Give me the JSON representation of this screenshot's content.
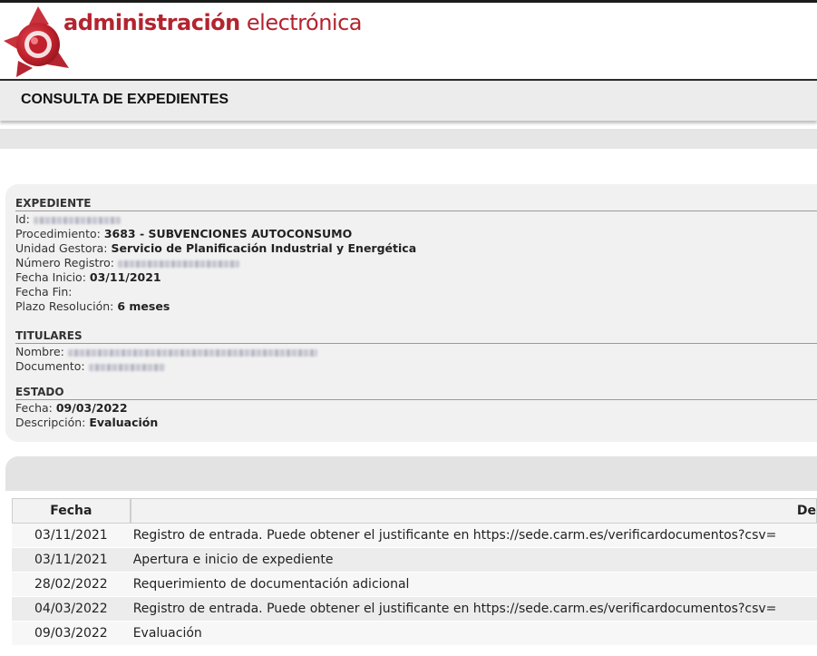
{
  "brand": {
    "bold": "administración",
    "light": " electrónica"
  },
  "page_title": "CONSULTA DE EXPEDIENTES",
  "expediente": {
    "title": "EXPEDIENTE",
    "id_label": "Id:",
    "procedimiento_label": "Procedimiento:",
    "procedimiento_value": "3683 - SUBVENCIONES AUTOCONSUMO",
    "unidad_label": "Unidad Gestora:",
    "unidad_value": "Servicio de Planificación Industrial y Energética",
    "registro_label": "Número Registro:",
    "fecha_inicio_label": "Fecha Inicio:",
    "fecha_inicio_value": "03/11/2021",
    "fecha_fin_label": "Fecha Fin:",
    "plazo_label": "Plazo Resolución:",
    "plazo_value": "6 meses"
  },
  "titulares": {
    "title": "TITULARES",
    "nombre_label": "Nombre:",
    "documento_label": "Documento:"
  },
  "estado": {
    "title": "ESTADO",
    "fecha_label": "Fecha:",
    "fecha_value": "09/03/2022",
    "descripcion_label": "Descripción:",
    "descripcion_value": "Evaluación"
  },
  "history": {
    "columns": [
      "Fecha",
      "De"
    ],
    "rows": [
      {
        "fecha": "03/11/2021",
        "desc": "Registro de entrada. Puede obtener el justificante en https://sede.carm.es/verificardocumentos?csv="
      },
      {
        "fecha": "03/11/2021",
        "desc": "Apertura e inicio de expediente"
      },
      {
        "fecha": "28/02/2022",
        "desc": "Requerimiento de documentación adicional"
      },
      {
        "fecha": "04/03/2022",
        "desc": "Registro de entrada. Puede obtener el justificante en https://sede.carm.es/verificardocumentos?csv="
      },
      {
        "fecha": "09/03/2022",
        "desc": "Evaluación"
      }
    ]
  },
  "colors": {
    "brand_red": "#b3242f",
    "panel_bg": "#f1f1f1"
  },
  "icons": {
    "logo": "administracion-electronica-logo"
  }
}
